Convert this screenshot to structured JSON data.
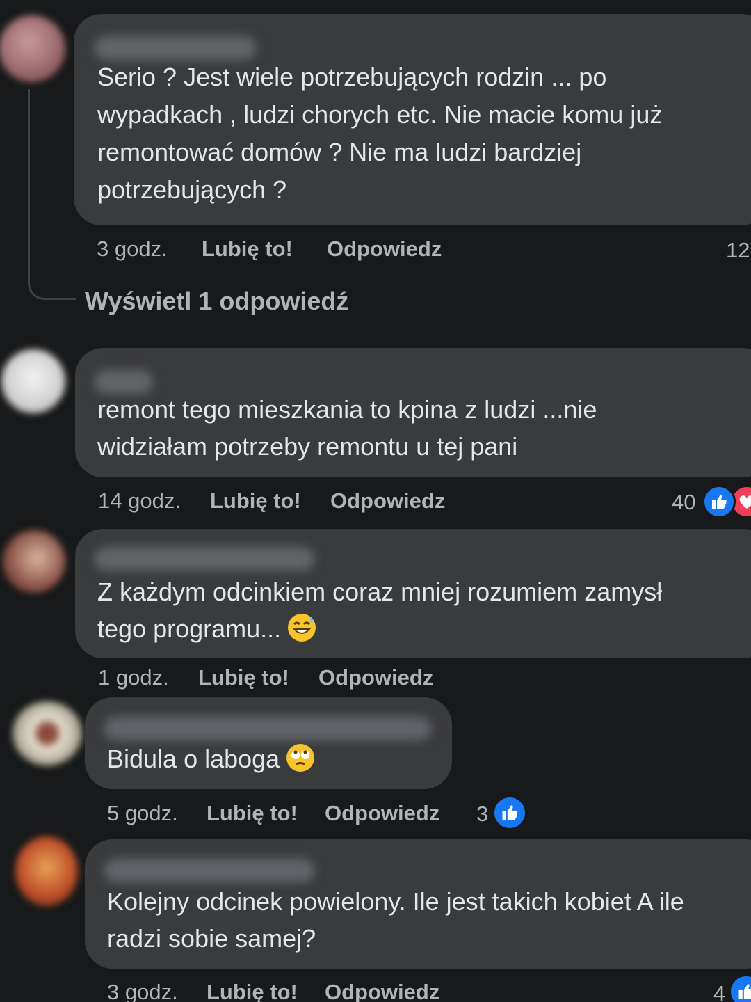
{
  "colors": {
    "background": "#18191a",
    "bubble": "#3a3b3c",
    "text": "#e4e6eb",
    "meta": "#b0b3b8",
    "like": "#1877f2",
    "love": "#f33e58"
  },
  "comments": [
    {
      "lines": [
        "Serio ? Jest wiele potrzebujących rodzin ... po",
        "wypadkach , ludzi chorych etc. Nie macie komu już",
        "remontować domów ? Nie ma ludzi bardziej",
        "potrzebujących ?"
      ],
      "time": "3 godz.",
      "like": "Lubię to!",
      "reply": "Odpowiedz",
      "reaction_count": "12",
      "view_replies": "Wyświetl 1 odpowiedź"
    },
    {
      "lines": [
        "remont tego mieszkania to kpina z ludzi ...nie",
        "widziałam potrzeby remontu u tej pani"
      ],
      "time": "14 godz.",
      "like": "Lubię to!",
      "reply": "Odpowiedz",
      "reaction_count": "40",
      "reactions": [
        "like-icon",
        "love-icon"
      ]
    },
    {
      "lines": [
        "Z każdym odcinkiem coraz mniej rozumiem zamysł",
        "tego programu..."
      ],
      "emoji": "grinning-sweat-emoji",
      "time": "1 godz.",
      "like": "Lubię to!",
      "reply": "Odpowiedz"
    },
    {
      "lines": [
        "Bidula o laboga"
      ],
      "emoji": "rolling-eyes-emoji",
      "time": "5 godz.",
      "like": "Lubię to!",
      "reply": "Odpowiedz",
      "reaction_count": "3",
      "reactions": [
        "like-icon"
      ]
    },
    {
      "lines": [
        "Kolejny odcinek powielony. Ile jest takich kobiet A ile",
        "radzi sobie samej?"
      ],
      "time": "3 godz.",
      "like": "Lubię to!",
      "reply": "Odpowiedz",
      "reaction_count": "4",
      "reactions": [
        "like-icon"
      ]
    }
  ]
}
